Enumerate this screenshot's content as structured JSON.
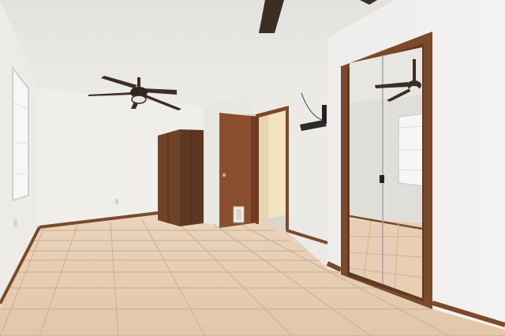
{
  "scene": {
    "kind": "photo",
    "colors": {
      "ceiling": "#e9e7e3",
      "wall_light": "#f0efed",
      "wall_shadow": "#dcdad6",
      "floor_tile": "#e6cdb2",
      "grout": "#cbb096",
      "wood_trim": "#7a4a2a",
      "door_wood": "#8a4f2e",
      "cabinet_wood": "#5e3720",
      "hallway_wall": "#f1e2c0",
      "mirror_tint": "#dedcd8",
      "window_glass": "#f7f7f7",
      "fan_dark": "#3a2e26"
    },
    "objects": [
      "ceiling-fan",
      "wall-cabinet",
      "interior-door",
      "hallway",
      "mirrored-closet-door",
      "window",
      "tile-floor",
      "baseboard",
      "tv-wall-mount"
    ]
  }
}
